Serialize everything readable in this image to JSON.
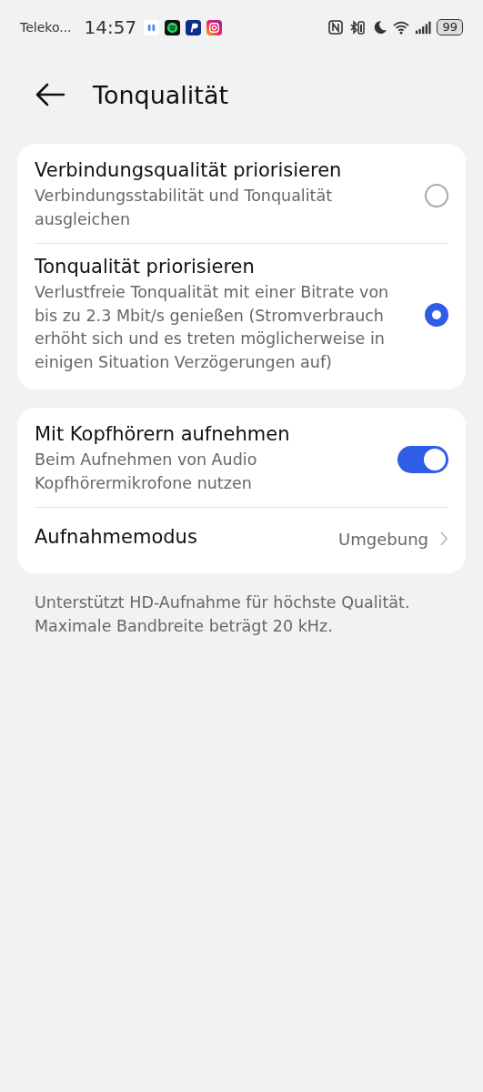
{
  "status_bar": {
    "carrier": "Teleko...",
    "time": "14:57",
    "battery": "99"
  },
  "header": {
    "title": "Tonqualität"
  },
  "quality_options": [
    {
      "title": "Verbindungsqualität priorisieren",
      "description": "Verbindungsstabilität und Tonqualität ausgleichen",
      "selected": false
    },
    {
      "title": "Tonqualität priorisieren",
      "description": "Verlustfreie Tonqualität mit einer Bitrate von bis zu 2.3 Mbit/s genießen (Stromverbrauch erhöht sich und es treten möglicherweise in einigen Situation Verzögerungen auf)",
      "selected": true
    }
  ],
  "recording": [
    {
      "kind": "toggle",
      "title": "Mit Kopfhörern aufnehmen",
      "description": "Beim Aufnehmen von Audio Kopfhörermikrofone nutzen",
      "on": true
    },
    {
      "kind": "link",
      "title": "Aufnahmemodus",
      "value": "Umgebung"
    }
  ],
  "footnote": "Unterstützt HD-Aufnahme für höchste Qualität. Maximale Bandbreite beträgt 20 kHz."
}
